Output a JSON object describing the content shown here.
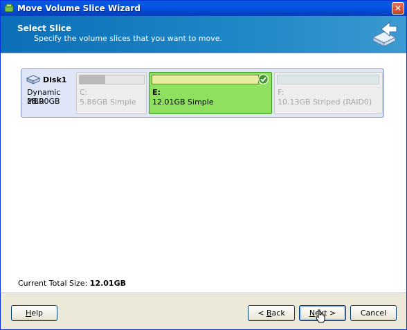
{
  "window": {
    "title": "Move Volume Slice Wizard",
    "close_label": "✕"
  },
  "header": {
    "title": "Select Slice",
    "subtitle": "Specify the volume slices that you want to move."
  },
  "disk": {
    "name": "Disk1",
    "type": "Dynamic MBR",
    "size": "28.00GB",
    "partitions": [
      {
        "label": "C:",
        "desc": "5.86GB Simple",
        "state": "disabled",
        "used_fraction": 0.4
      },
      {
        "label": "E:",
        "desc": "12.01GB Simple",
        "state": "selected",
        "used_fraction": 1.0
      },
      {
        "label": "F:",
        "desc": "10.13GB Striped (RAID0)",
        "state": "disabled",
        "used_fraction": 0.0
      }
    ]
  },
  "summary": {
    "label": "Current Total Size:",
    "value": "12.01GB"
  },
  "buttons": {
    "help": {
      "pre": "",
      "key": "H",
      "post": "elp"
    },
    "back": {
      "pre": "< ",
      "key": "B",
      "post": "ack"
    },
    "next": {
      "pre": "",
      "key": "N",
      "post": "ext >"
    },
    "cancel": "Cancel"
  },
  "colors": {
    "selected_partition": "#8ee05e",
    "header_bg": "#1f88c7",
    "title_bar": "#0354e6"
  }
}
